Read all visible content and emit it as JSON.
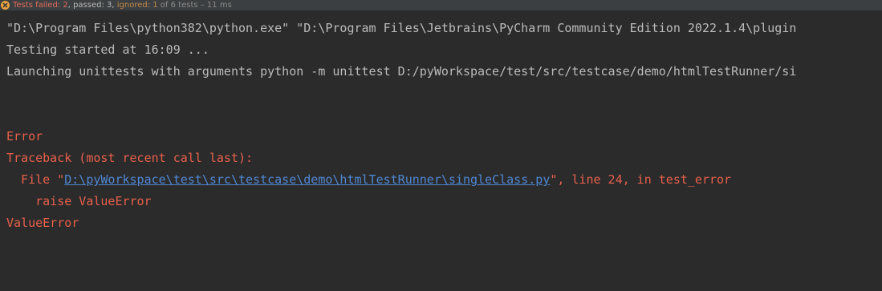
{
  "status": {
    "failed_label": "Tests failed: 2",
    "separator_comma": ", ",
    "passed_label": "passed: 3",
    "separator_comma2": ", ",
    "ignored_label": "ignored: 1",
    "of_label": " of 6 tests – 11 ms",
    "icon": "error-badge-icon",
    "colors": {
      "failed": "#e06c5a",
      "passed": "#b8b8b8",
      "ignored": "#c0884a"
    }
  },
  "console": {
    "cmd_line": "\"D:\\Program Files\\python382\\python.exe\" \"D:\\Program Files\\Jetbrains\\PyCharm Community Edition 2022.1.4\\plugin",
    "testing_started": "Testing started at 16:09 ...",
    "launching": "Launching unittests with arguments python -m unittest D:/pyWorkspace/test/src/testcase/demo/htmlTestRunner/si",
    "error_label": "Error",
    "traceback_header": "Traceback (most recent call last):",
    "file_prefix": "  File \"",
    "file_link": "D:\\pyWorkspace\\test\\src\\testcase\\demo\\htmlTestRunner\\singleClass.py",
    "file_suffix": "\", line 24, in test_error",
    "raise_line": "    raise ValueError",
    "exception_line": "ValueError",
    "colors": {
      "background": "#2b2b2b",
      "normal_text": "#bbbbbb",
      "error_text": "#e8604c",
      "link": "#4f87d4"
    }
  }
}
